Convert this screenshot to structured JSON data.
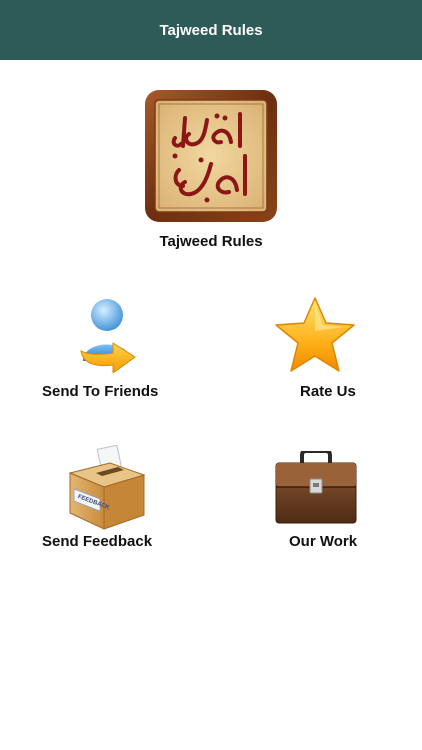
{
  "header": {
    "title": "Tajweed Rules"
  },
  "app": {
    "name": "Tajweed Rules",
    "logo_icon": "tajweed-calligraphy-logo"
  },
  "menu": {
    "send_to_friends": {
      "label": "Send To Friends",
      "icon": "contact-share-icon"
    },
    "rate_us": {
      "label": "Rate Us",
      "icon": "star-icon"
    },
    "send_feedback": {
      "label": "Send Feedback",
      "icon": "feedback-box-icon"
    },
    "our_work": {
      "label": "Our Work",
      "icon": "briefcase-icon"
    }
  },
  "colors": {
    "navbar": "#2e5a57",
    "background": "#ffffff"
  }
}
